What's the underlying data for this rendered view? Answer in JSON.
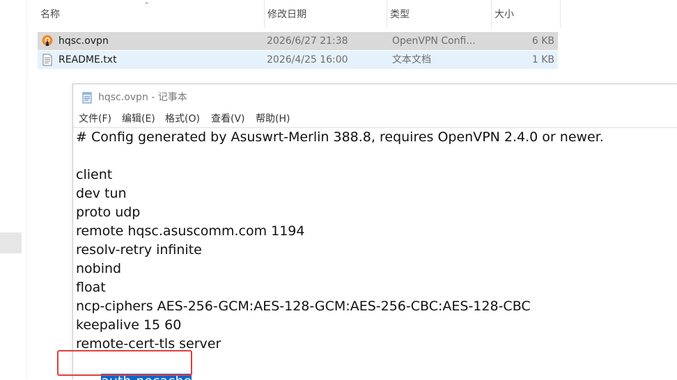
{
  "explorer": {
    "columns": {
      "name": "名称",
      "modified": "修改日期",
      "type": "类型",
      "size": "大小"
    },
    "files": [
      {
        "name": "hqsc.ovpn",
        "modified": "2026/6/27 21:38",
        "type": "OpenVPN Confi...",
        "size": "6 KB",
        "icon": "openvpn-icon"
      },
      {
        "name": "README.txt",
        "modified": "2026/4/25 16:00",
        "type": "文本文档",
        "size": "1 KB",
        "icon": "text-file-icon"
      }
    ]
  },
  "notepad": {
    "title": "hqsc.ovpn - 记事本",
    "menu": [
      "文件(F)",
      "编辑(E)",
      "格式(O)",
      "查看(V)",
      "帮助(H)"
    ],
    "lines": [
      "# Config generated by Asuswrt-Merlin 388.8, requires OpenVPN 2.4.0 or newer.",
      "",
      "client",
      "dev tun",
      "proto udp",
      "remote hqsc.asuscomm.com 1194",
      "resolv-retry infinite",
      "nobind",
      "float",
      "ncp-ciphers AES-256-GCM:AES-128-GCM:AES-256-CBC:AES-128-CBC",
      "keepalive 15 60",
      "remote-cert-tls server"
    ],
    "selected_line": "auth-nocache"
  },
  "colors": {
    "selection": "#0a66cc",
    "annotation": "#e43c3c",
    "row_selected": "#d9d9d9",
    "row_hover": "#e5f1fb"
  }
}
